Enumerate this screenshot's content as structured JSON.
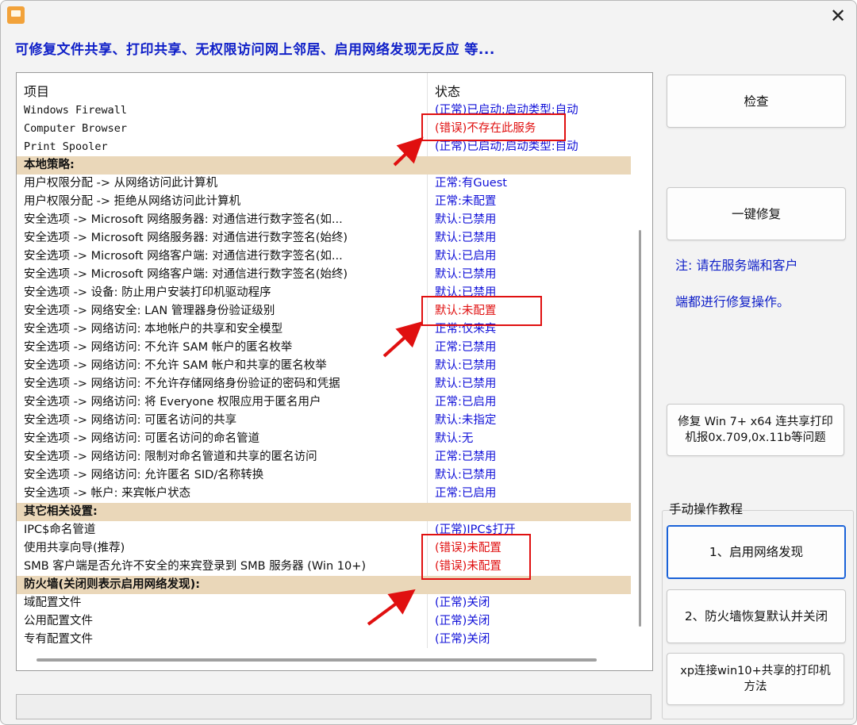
{
  "banner": "可修复文件共享、打印共享、无权限访问网上邻居、启用网络发现无反应  等...",
  "title_bar": {
    "close_glyph": "✕"
  },
  "list": {
    "col_item": "项目",
    "col_status": "状态",
    "rows": [
      {
        "item": "Windows Firewall",
        "status": "(正常)已启动;启动类型:自动",
        "mono": true
      },
      {
        "item": "Computer Browser",
        "status": "(错误)不存在此服务",
        "mono": true,
        "error": true
      },
      {
        "item": "Print Spooler",
        "status": "(正常)已启动;启动类型:自动",
        "mono": true
      },
      {
        "item": "本地策略:",
        "status": "",
        "section": true
      },
      {
        "item": "用户权限分配 -> 从网络访问此计算机",
        "status": "正常:有Guest"
      },
      {
        "item": "用户权限分配 -> 拒绝从网络访问此计算机",
        "status": "正常:未配置"
      },
      {
        "item": "安全选项 -> Microsoft 网络服务器: 对通信进行数字签名(如...",
        "status": "默认:已禁用"
      },
      {
        "item": "安全选项 -> Microsoft 网络服务器: 对通信进行数字签名(始终)",
        "status": "默认:已禁用"
      },
      {
        "item": "安全选项 -> Microsoft 网络客户端: 对通信进行数字签名(如...",
        "status": "默认:已启用"
      },
      {
        "item": "安全选项 -> Microsoft 网络客户端: 对通信进行数字签名(始终)",
        "status": "默认:已禁用"
      },
      {
        "item": "安全选项 -> 设备: 防止用户安装打印机驱动程序",
        "status": "默认:已禁用"
      },
      {
        "item": "安全选项 -> 网络安全: LAN 管理器身份验证级别",
        "status": "默认:未配置",
        "error": true
      },
      {
        "item": "安全选项 -> 网络访问: 本地帐户的共享和安全模型",
        "status": "正常:仅来宾"
      },
      {
        "item": "安全选项 -> 网络访问: 不允许 SAM 帐户的匿名枚举",
        "status": "正常:已禁用"
      },
      {
        "item": "安全选项 -> 网络访问: 不允许 SAM 帐户和共享的匿名枚举",
        "status": "默认:已禁用"
      },
      {
        "item": "安全选项 -> 网络访问: 不允许存储网络身份验证的密码和凭据",
        "status": "默认:已禁用"
      },
      {
        "item": "安全选项 -> 网络访问: 将 Everyone 权限应用于匿名用户",
        "status": "正常:已启用"
      },
      {
        "item": "安全选项 -> 网络访问: 可匿名访问的共享",
        "status": "默认:未指定"
      },
      {
        "item": "安全选项 -> 网络访问: 可匿名访问的命名管道",
        "status": "默认:无"
      },
      {
        "item": "安全选项 -> 网络访问: 限制对命名管道和共享的匿名访问",
        "status": "正常:已禁用"
      },
      {
        "item": "安全选项 -> 网络访问: 允许匿名 SID/名称转换",
        "status": "默认:已禁用"
      },
      {
        "item": "安全选项 -> 帐户: 来宾帐户状态",
        "status": "正常:已启用"
      },
      {
        "item": "其它相关设置:",
        "status": "",
        "section": true
      },
      {
        "item": "IPC$命名管道",
        "status": "(正常)IPC$打开"
      },
      {
        "item": "使用共享向导(推荐)",
        "status": "(错误)未配置",
        "error": true
      },
      {
        "item": "SMB 客户端是否允许不安全的来宾登录到 SMB 服务器 (Win 10+)",
        "status": "(错误)未配置",
        "error": true
      },
      {
        "item": "防火墙(关闭则表示启用网络发现):",
        "status": "",
        "section": true
      },
      {
        "item": "域配置文件",
        "status": "(正常)关闭"
      },
      {
        "item": "公用配置文件",
        "status": "(正常)关闭"
      },
      {
        "item": "专有配置文件",
        "status": "(正常)关闭"
      }
    ]
  },
  "buttons": {
    "check": "检查",
    "one_click_fix": "一键修复",
    "fix_win7_printer": "修复 Win 7+ x64 连共享打印机报0x.709,0x.11b等问题",
    "enable_discovery": "1、启用网络发现",
    "firewall_reset": "2、防火墙恢复默认并关闭",
    "xp_connect": "xp连接win10+共享的打印机方法"
  },
  "note": {
    "line1": "注: 请在服务端和客户",
    "line2": "端都进行修复操作。"
  },
  "manual_group_label": "手动操作教程",
  "colors": {
    "accent_blue": "#1020c8",
    "error_red": "#e01010",
    "section_bg": "#ead7b9",
    "primary_border": "#1a62d8"
  }
}
